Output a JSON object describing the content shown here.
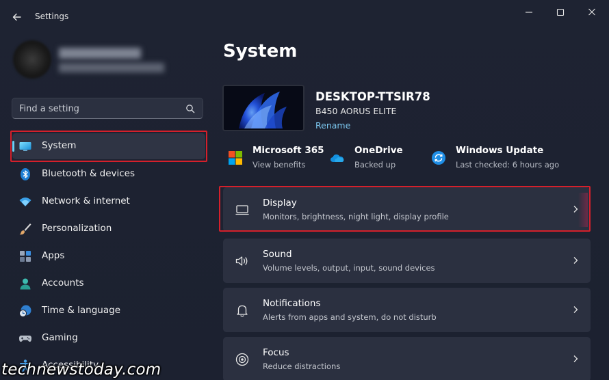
{
  "window": {
    "title": "Settings",
    "colors": {
      "background": "#1e2332",
      "card": "#2b3040",
      "accent": "#6ccff6",
      "highlight_border": "#d5202b",
      "link": "#7cc7ef"
    }
  },
  "sidebar": {
    "user": {
      "name": "",
      "email": ""
    },
    "search": {
      "placeholder": "Find a setting",
      "value": ""
    },
    "items": [
      {
        "label": "System",
        "icon": "monitor-icon",
        "active": true
      },
      {
        "label": "Bluetooth & devices",
        "icon": "bluetooth-icon"
      },
      {
        "label": "Network & internet",
        "icon": "wifi-icon"
      },
      {
        "label": "Personalization",
        "icon": "paintbrush-icon"
      },
      {
        "label": "Apps",
        "icon": "apps-icon"
      },
      {
        "label": "Accounts",
        "icon": "account-icon"
      },
      {
        "label": "Time & language",
        "icon": "globe-clock-icon"
      },
      {
        "label": "Gaming",
        "icon": "gamepad-icon"
      },
      {
        "label": "Accessibility",
        "icon": "accessibility-icon"
      }
    ]
  },
  "main": {
    "page_title": "System",
    "device": {
      "name": "DESKTOP-TTSIR78",
      "model": "B450 AORUS ELITE",
      "rename_label": "Rename"
    },
    "quick_links": [
      {
        "title": "Microsoft 365",
        "subtitle": "View benefits",
        "icon": "microsoft-365-icon"
      },
      {
        "title": "OneDrive",
        "subtitle": "Backed up",
        "icon": "onedrive-icon"
      },
      {
        "title": "Windows Update",
        "subtitle": "Last checked: 6 hours ago",
        "icon": "windows-update-icon"
      }
    ],
    "cards": [
      {
        "title": "Display",
        "subtitle": "Monitors, brightness, night light, display profile",
        "icon": "display-icon"
      },
      {
        "title": "Sound",
        "subtitle": "Volume levels, output, input, sound devices",
        "icon": "speaker-icon"
      },
      {
        "title": "Notifications",
        "subtitle": "Alerts from apps and system, do not disturb",
        "icon": "bell-icon"
      },
      {
        "title": "Focus",
        "subtitle": "Reduce distractions",
        "icon": "focus-icon"
      }
    ]
  },
  "watermark": {
    "text": "technewstoday.com"
  }
}
